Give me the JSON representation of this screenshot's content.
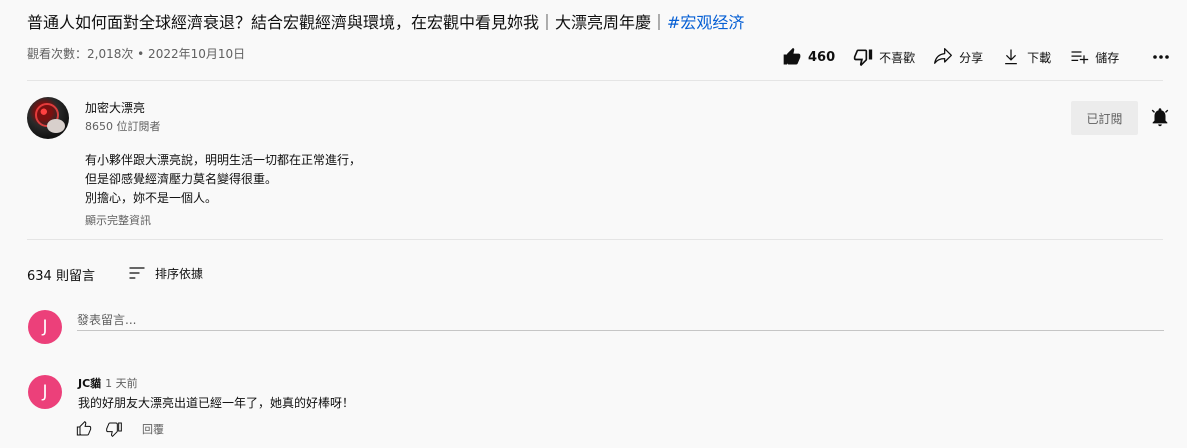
{
  "video": {
    "title_main": "普通人如何面對全球經濟衰退？結合宏觀經濟與環境，在宏觀中看見妳我｜大漂亮周年慶｜",
    "title_hashtag": "#宏观经济",
    "meta": "觀看次數：2,018次 • 2022年10月10日"
  },
  "actions": {
    "like_count": "460",
    "dislike_label": "不喜歡",
    "share_label": "分享",
    "download_label": "下載",
    "save_label": "儲存"
  },
  "channel": {
    "name": "加密大漂亮",
    "subscribers": "8650 位訂閱者",
    "subscribe_label": "已訂閱"
  },
  "description": {
    "lines": [
      "有小夥伴跟大漂亮說，明明生活一切都在正常進行，",
      "但是卻感覺經濟壓力莫名變得很重。",
      "別擔心，妳不是一個人。"
    ],
    "show_more": "顯示完整資訊"
  },
  "comments": {
    "count_label": "634 則留言",
    "sort_label": "排序依據",
    "add_placeholder": "發表留言...",
    "user_initial": "J",
    "items": [
      {
        "initial": "J",
        "author": "JC貓",
        "time": "1 天前",
        "text": "我的好朋友大漂亮出道已經一年了，她真的好棒呀！",
        "reply_label": "回覆"
      }
    ]
  },
  "colors": {
    "background": "#f9f9f9",
    "hashtag": "#065fd4",
    "avatar_pink": "#ec407a",
    "secondary_text": "#606060"
  }
}
